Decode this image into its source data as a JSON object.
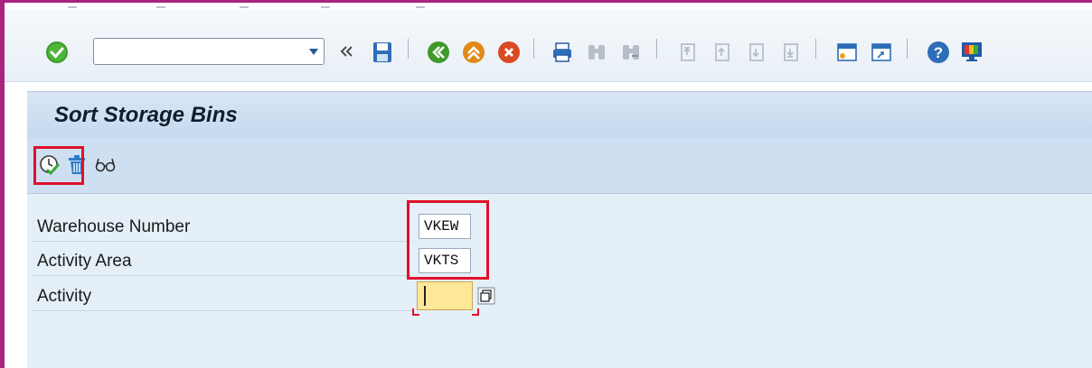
{
  "toolbar": {
    "command_field_value": "",
    "icons": [
      "check-icon",
      "dropdown-icon",
      "back-double-chevron-icon",
      "save-icon",
      "back-icon",
      "exit-icon",
      "cancel-icon",
      "print-icon",
      "find-icon",
      "find-next-icon",
      "first-page-icon",
      "previous-page-icon",
      "next-page-icon",
      "last-page-icon",
      "create-session-icon",
      "shortcut-icon",
      "help-icon",
      "customize-layout-icon"
    ]
  },
  "title": {
    "text": "Sort Storage Bins"
  },
  "app_toolbar": {
    "icons": [
      "execute-icon",
      "delete-icon",
      "display-icon"
    ]
  },
  "form": {
    "fields": [
      {
        "label": "Warehouse Number",
        "value": "VKEW"
      },
      {
        "label": "Activity Area",
        "value": "VKTS"
      },
      {
        "label": "Activity",
        "value": ""
      }
    ]
  },
  "colors": {
    "frame": "#a8247e",
    "highlight": "#e0102a",
    "title_bg": "#c6d9ee",
    "active_field": "#fde89a"
  }
}
